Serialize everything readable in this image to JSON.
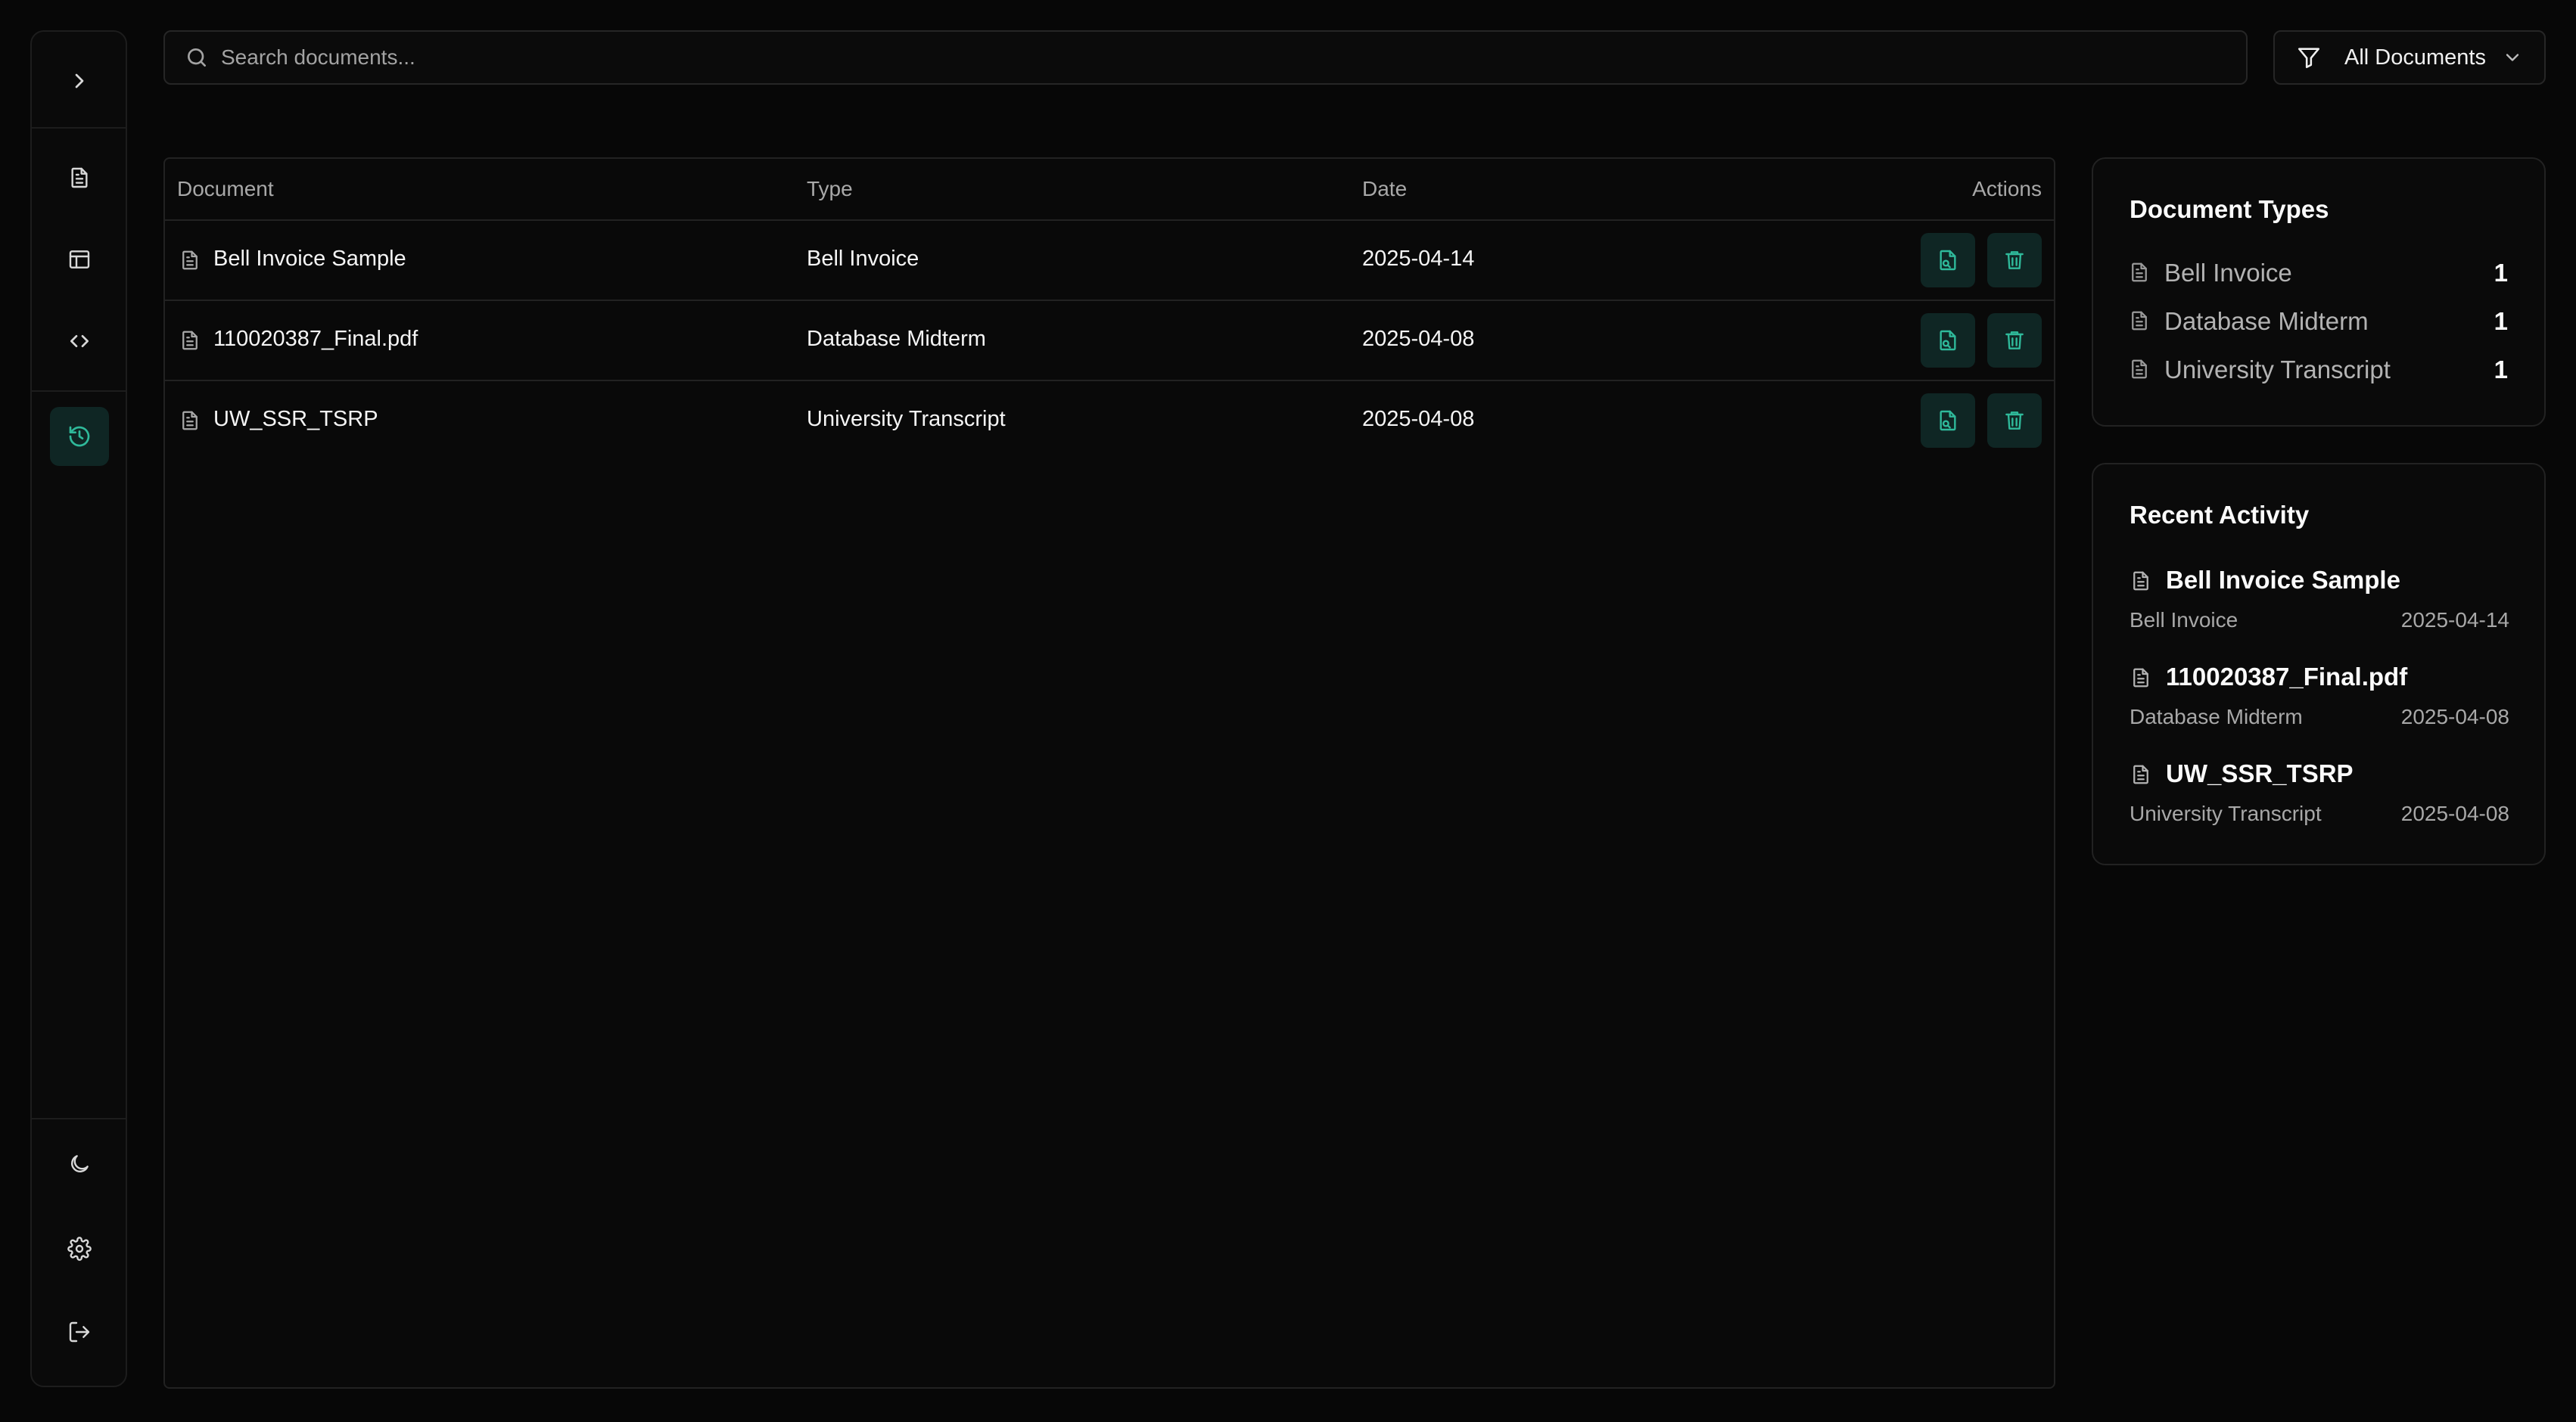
{
  "search": {
    "placeholder": "Search documents..."
  },
  "filter": {
    "label": "All Documents"
  },
  "sidebar": {
    "items": [
      {
        "name": "expand",
        "icon": "chevron-right-icon"
      },
      {
        "name": "documents",
        "icon": "file-text-icon"
      },
      {
        "name": "templates",
        "icon": "layout-icon"
      },
      {
        "name": "code",
        "icon": "code-icon"
      },
      {
        "name": "history",
        "icon": "history-icon",
        "active": true
      },
      {
        "name": "theme",
        "icon": "moon-icon"
      },
      {
        "name": "settings",
        "icon": "gear-icon"
      },
      {
        "name": "logout",
        "icon": "log-out-icon"
      }
    ]
  },
  "table": {
    "headers": {
      "document": "Document",
      "type": "Type",
      "date": "Date",
      "actions": "Actions"
    },
    "rows": [
      {
        "document": "Bell Invoice Sample",
        "type": "Bell Invoice",
        "date": "2025-04-14"
      },
      {
        "document": "110020387_Final.pdf",
        "type": "Database Midterm",
        "date": "2025-04-08"
      },
      {
        "document": "UW_SSR_TSRP",
        "type": "University Transcript",
        "date": "2025-04-08"
      }
    ]
  },
  "document_types": {
    "title": "Document Types",
    "items": [
      {
        "label": "Bell Invoice",
        "count": "1"
      },
      {
        "label": "Database Midterm",
        "count": "1"
      },
      {
        "label": "University Transcript",
        "count": "1"
      }
    ]
  },
  "recent_activity": {
    "title": "Recent Activity",
    "items": [
      {
        "title": "Bell Invoice Sample",
        "type": "Bell Invoice",
        "date": "2025-04-14"
      },
      {
        "title": "110020387_Final.pdf",
        "type": "Database Midterm",
        "date": "2025-04-08"
      },
      {
        "title": "UW_SSR_TSRP",
        "type": "University Transcript",
        "date": "2025-04-08"
      }
    ]
  },
  "colors": {
    "background": "#070707",
    "accent": "#2fb99a",
    "accent_bg": "#0f2624",
    "border": "#222222"
  }
}
